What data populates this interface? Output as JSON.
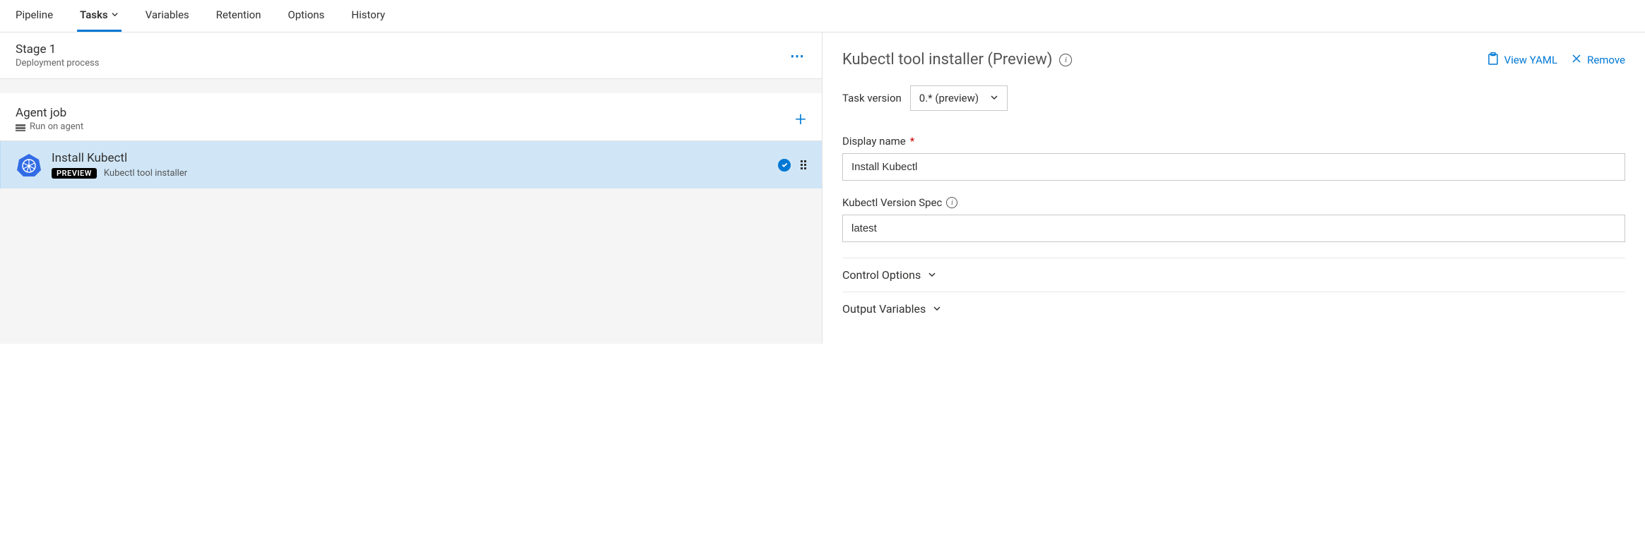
{
  "tabs": {
    "pipeline": "Pipeline",
    "tasks": "Tasks",
    "variables": "Variables",
    "retention": "Retention",
    "options": "Options",
    "history": "History"
  },
  "stage": {
    "title": "Stage 1",
    "subtitle": "Deployment process"
  },
  "agent": {
    "title": "Agent job",
    "subtitle": "Run on agent"
  },
  "task": {
    "title": "Install Kubectl",
    "badge": "PREVIEW",
    "desc": "Kubectl tool installer"
  },
  "right": {
    "title": "Kubectl tool installer (Preview)",
    "view_yaml": "View YAML",
    "remove": "Remove",
    "task_version_label": "Task version",
    "task_version_value": "0.* (preview)",
    "display_name_label": "Display name",
    "display_name_value": "Install Kubectl",
    "version_spec_label": "Kubectl Version Spec",
    "version_spec_value": "latest",
    "control_options": "Control Options",
    "output_variables": "Output Variables"
  }
}
